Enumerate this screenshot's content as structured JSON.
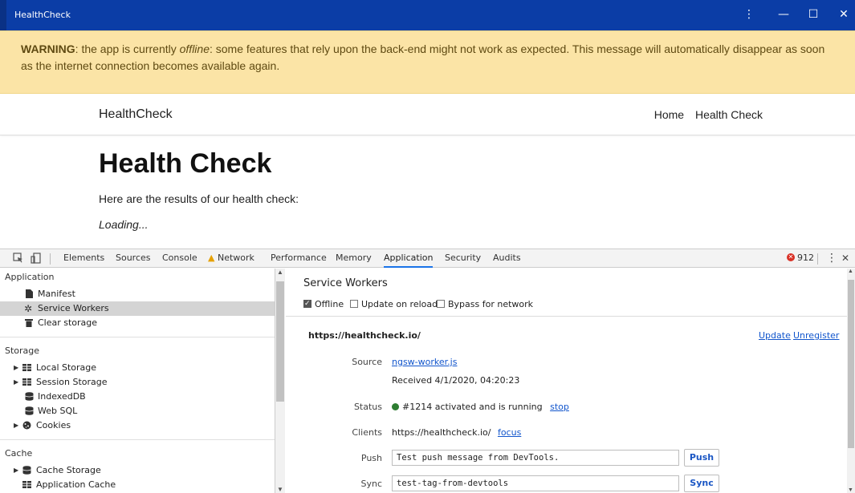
{
  "window": {
    "title": "HealthCheck",
    "menu_glyph": "⋮",
    "minimize_glyph": "—",
    "maximize_glyph": "☐",
    "close_glyph": "✕"
  },
  "warning": {
    "label": "WARNING",
    "text_1": ": the app is currently ",
    "offline": "offline",
    "text_2": ": some features that rely upon the back-end might not work as expected. This message will automatically disappear as soon as the internet connection becomes available again."
  },
  "navbar": {
    "brand": "HealthCheck",
    "links": [
      "Home",
      "Health Check"
    ]
  },
  "page": {
    "heading": "Health Check",
    "subtitle": "Here are the results of our health check:",
    "loading": "Loading..."
  },
  "devtools": {
    "tabs": [
      "Elements",
      "Sources",
      "Console",
      "Network",
      "Performance",
      "Memory",
      "Application",
      "Security",
      "Audits"
    ],
    "active_tab": "Application",
    "error_count": "912",
    "kebab_glyph": "⋮",
    "close_glyph": "✕",
    "sidebar": {
      "application_header": "Application",
      "manifest": "Manifest",
      "service_workers": "Service Workers",
      "clear_storage": "Clear storage",
      "storage_header": "Storage",
      "local_storage": "Local Storage",
      "session_storage": "Session Storage",
      "indexeddb": "IndexedDB",
      "web_sql": "Web SQL",
      "cookies": "Cookies",
      "cache_header": "Cache",
      "cache_storage": "Cache Storage",
      "application_cache": "Application Cache"
    },
    "main": {
      "title": "Service Workers",
      "options": {
        "offline": "Offline",
        "update_on_reload": "Update on reload",
        "bypass_for_network": "Bypass for network"
      },
      "offline_checked": true,
      "origin": "https://healthcheck.io/",
      "update_link": "Update",
      "unregister_link": "Unregister",
      "source_label": "Source",
      "source_file": "ngsw-worker.js",
      "received": "Received 4/1/2020, 04:20:23",
      "status_label": "Status",
      "status_text": "#1214 activated and is running",
      "stop_link": "stop",
      "status_color": "#2e7d32",
      "clients_label": "Clients",
      "clients_value": "https://healthcheck.io/",
      "focus_link": "focus",
      "push_label": "Push",
      "push_value": "Test push message from DevTools.",
      "push_button": "Push",
      "sync_label": "Sync",
      "sync_value": "test-tag-from-devtools",
      "sync_button": "Sync"
    }
  }
}
